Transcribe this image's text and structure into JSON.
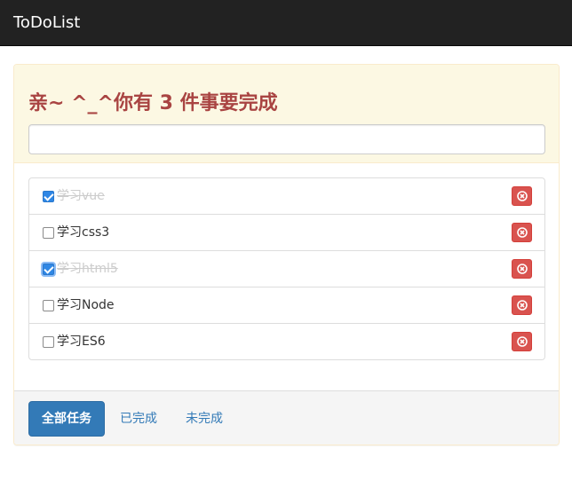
{
  "navbar": {
    "brand": "ToDoList"
  },
  "heading": {
    "prefix": "亲~ ^_^你有 ",
    "count": "3",
    "suffix": " 件事要完成"
  },
  "new_task": {
    "value": "",
    "placeholder": ""
  },
  "tasks": [
    {
      "label": "学习vue",
      "completed": true
    },
    {
      "label": "学习css3",
      "completed": false
    },
    {
      "label": "学习html5",
      "completed": true
    },
    {
      "label": "学习Node",
      "completed": false
    },
    {
      "label": "学习ES6",
      "completed": false
    }
  ],
  "filters": {
    "all": "全部任务",
    "done": "已完成",
    "undone": "未完成",
    "selected": "all"
  },
  "colors": {
    "navbar_bg": "#222222",
    "heading_text": "#a94442",
    "heading_bg": "#fcf8e3",
    "delete_button": "#d9534f",
    "primary_button": "#337ab7",
    "completed_text": "#cccccc"
  }
}
